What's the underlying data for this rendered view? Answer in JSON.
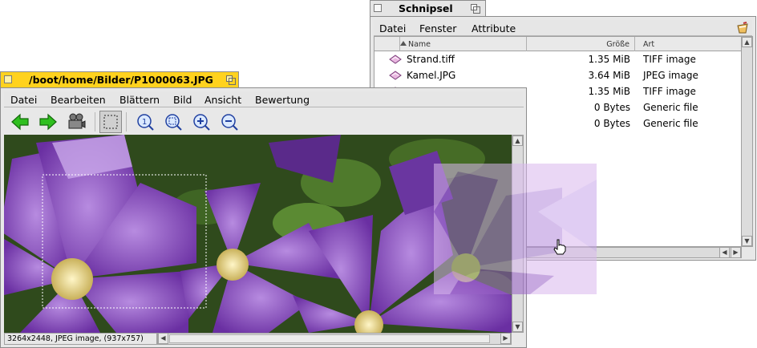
{
  "colors": {
    "active_tab": "#ffd21e",
    "inactive_tab": "#e5e5e5",
    "window_bg": "#e8e8e8",
    "arrow_green": "#2fbf1f",
    "photo_purple": "#8b4fc0",
    "drag_overlay": "#e8c8f4"
  },
  "viewer": {
    "title": "/boot/home/Bilder/P1000063.JPG",
    "menu": [
      "Datei",
      "Bearbeiten",
      "Blättern",
      "Bild",
      "Ansicht",
      "Bewertung"
    ],
    "toolbar_icons": [
      "back-arrow-icon",
      "forward-arrow-icon",
      "slideshow-projector-icon",
      "selection-mode-icon",
      "original-size-icon",
      "fit-to-window-icon",
      "zoom-in-icon",
      "zoom-out-icon"
    ],
    "status": "3264x2448, JPEG image, (937x757)"
  },
  "tracker": {
    "title": "Schnipsel",
    "menu": [
      "Datei",
      "Fenster",
      "Attribute"
    ],
    "columns": {
      "name": "Name",
      "size": "Größe",
      "type": "Art"
    },
    "files": [
      {
        "name": "Strand.tiff",
        "size": "1.35 MiB",
        "type": "TIFF image",
        "icon": "image-file-icon"
      },
      {
        "name": "Kamel.JPG",
        "size": "3.64 MiB",
        "type": "JPEG image",
        "icon": "image-file-icon"
      },
      {
        "name": "",
        "size": "1.35 MiB",
        "type": "TIFF image",
        "icon": "image-file-icon"
      },
      {
        "name": "",
        "size": "0 Bytes",
        "type": "Generic file",
        "icon": "generic-file-icon"
      },
      {
        "name": "",
        "size": "0 Bytes",
        "type": "Generic file",
        "icon": "generic-file-icon"
      }
    ]
  }
}
